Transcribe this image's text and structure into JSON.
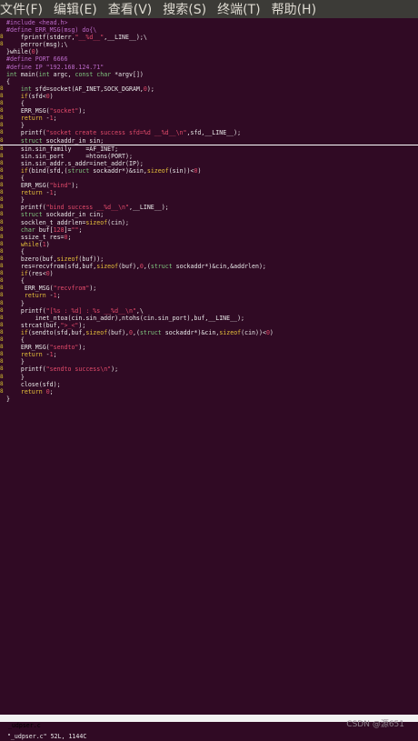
{
  "menubar": {
    "items": [
      "文件(F)",
      "编辑(E)",
      "查看(V)",
      "搜索(S)",
      "终端(T)",
      "帮助(H)"
    ]
  },
  "editor": {
    "cursor_line_index": 16,
    "lines": [
      {
        "g": "",
        "t": [
          [
            "pp",
            "#include <head.h>"
          ]
        ]
      },
      {
        "g": "",
        "t": [
          [
            "pp",
            "#define ERR_MSG(msg) do{\\"
          ]
        ]
      },
      {
        "g": "8",
        "t": [
          [
            "code",
            "    fprintf(stderr,"
          ],
          [
            "str",
            "\"__%d__\""
          ],
          [
            "code",
            ",__LINE__);\\"
          ]
        ]
      },
      {
        "g": "8",
        "t": [
          [
            "code",
            "    perror(msg);\\"
          ]
        ]
      },
      {
        "g": "",
        "t": [
          [
            "code",
            "}while("
          ],
          [
            "num",
            "0"
          ],
          [
            "code",
            ")"
          ]
        ]
      },
      {
        "g": "",
        "t": [
          [
            "pp",
            "#define PORT 6666"
          ]
        ]
      },
      {
        "g": "",
        "t": [
          [
            "pp",
            "#define IP \"192.168.124.71\""
          ]
        ]
      },
      {
        "g": "",
        "t": [
          [
            "ty",
            "int"
          ],
          [
            "code",
            " main("
          ],
          [
            "ty",
            "int"
          ],
          [
            "code",
            " argc, "
          ],
          [
            "ty",
            "const char"
          ],
          [
            "code",
            " *argv[])"
          ]
        ]
      },
      {
        "g": "",
        "t": [
          [
            "code",
            "{"
          ]
        ]
      },
      {
        "g": "8",
        "t": [
          [
            "ty",
            "    int"
          ],
          [
            "code",
            " sfd=socket(AF_INET,SOCK_DGRAM,"
          ],
          [
            "num",
            "0"
          ],
          [
            "code",
            ");"
          ]
        ]
      },
      {
        "g": "8",
        "t": [
          [
            "kw",
            "    if"
          ],
          [
            "code",
            "(sfd<"
          ],
          [
            "num",
            "0"
          ],
          [
            "code",
            ")"
          ]
        ]
      },
      {
        "g": "8",
        "t": [
          [
            "code",
            "    {"
          ]
        ]
      },
      {
        "g": "8",
        "t": [
          [
            "code",
            "    ERR_MSG("
          ],
          [
            "str",
            "\"socket\""
          ],
          [
            "code",
            ");"
          ]
        ]
      },
      {
        "g": "8",
        "t": [
          [
            "kw",
            "    return"
          ],
          [
            "code",
            " -"
          ],
          [
            "num",
            "1"
          ],
          [
            "code",
            ";"
          ]
        ]
      },
      {
        "g": "8",
        "t": [
          [
            "code",
            "    }"
          ]
        ]
      },
      {
        "g": "8",
        "t": [
          [
            "code",
            "    printf("
          ],
          [
            "str",
            "\"socket create success sfd=%d __%d__\\n\""
          ],
          [
            "code",
            ",sfd,__LINE__);"
          ]
        ]
      },
      {
        "g": "8",
        "t": [
          [
            "ty",
            "    struct"
          ],
          [
            "code",
            " sockaddr_in sin;"
          ]
        ]
      },
      {
        "g": "8",
        "t": [
          [
            "code",
            "    sin.sin_family    =AF_INET;"
          ]
        ]
      },
      {
        "g": "8",
        "t": [
          [
            "code",
            "    sin.sin_port      =htons(PORT);"
          ]
        ]
      },
      {
        "g": "8",
        "t": [
          [
            "code",
            "    sin.sin_addr.s_addr=inet_addr(IP);"
          ]
        ]
      },
      {
        "g": "8",
        "t": [
          [
            "kw",
            "    if"
          ],
          [
            "code",
            "(bind(sfd,("
          ],
          [
            "ty",
            "struct"
          ],
          [
            "code",
            " sockaddr*)&sin,"
          ],
          [
            "kw",
            "sizeof"
          ],
          [
            "code",
            "(sin))<"
          ],
          [
            "num",
            "0"
          ],
          [
            "code",
            ")"
          ]
        ]
      },
      {
        "g": "8",
        "t": [
          [
            "code",
            "    {"
          ]
        ]
      },
      {
        "g": "8",
        "t": [
          [
            "code",
            "    ERR_MSG("
          ],
          [
            "str",
            "\"bind\""
          ],
          [
            "code",
            ");"
          ]
        ]
      },
      {
        "g": "8",
        "t": [
          [
            "kw",
            "    return"
          ],
          [
            "code",
            " -"
          ],
          [
            "num",
            "1"
          ],
          [
            "code",
            ";"
          ]
        ]
      },
      {
        "g": "8",
        "t": [
          [
            "code",
            "    }"
          ]
        ]
      },
      {
        "g": "8",
        "t": [
          [
            "code",
            "    printf("
          ],
          [
            "str",
            "\"bind success __%d__\\n\""
          ],
          [
            "code",
            ",__LINE__);"
          ]
        ]
      },
      {
        "g": "8",
        "t": [
          [
            "ty",
            "    struct"
          ],
          [
            "code",
            " sockaddr_in cin;"
          ]
        ]
      },
      {
        "g": "8",
        "t": [
          [
            "code",
            "    socklen_t addrlen="
          ],
          [
            "kw",
            "sizeof"
          ],
          [
            "code",
            "(cin);"
          ]
        ]
      },
      {
        "g": "8",
        "t": [
          [
            "ty",
            "    char"
          ],
          [
            "code",
            " buf["
          ],
          [
            "num",
            "128"
          ],
          [
            "code",
            "]="
          ],
          [
            "str",
            "\"\""
          ],
          [
            "code",
            ";"
          ]
        ]
      },
      {
        "g": "8",
        "t": [
          [
            "code",
            "    ssize_t res="
          ],
          [
            "num",
            "0"
          ],
          [
            "code",
            ";"
          ]
        ]
      },
      {
        "g": "8",
        "t": [
          [
            "kw",
            "    while"
          ],
          [
            "code",
            "("
          ],
          [
            "num",
            "1"
          ],
          [
            "code",
            ")"
          ]
        ]
      },
      {
        "g": "8",
        "t": [
          [
            "code",
            "    {"
          ]
        ]
      },
      {
        "g": "8",
        "t": [
          [
            "code",
            "    bzero(buf,"
          ],
          [
            "kw",
            "sizeof"
          ],
          [
            "code",
            "(buf));"
          ]
        ]
      },
      {
        "g": "8",
        "t": [
          [
            "code",
            "    res=recvfrom(sfd,buf,"
          ],
          [
            "kw",
            "sizeof"
          ],
          [
            "code",
            "(buf),"
          ],
          [
            "num",
            "0"
          ],
          [
            "code",
            ",("
          ],
          [
            "ty",
            "struct"
          ],
          [
            "code",
            " sockaddr*)&cin,&addrlen);"
          ]
        ]
      },
      {
        "g": "8",
        "t": [
          [
            "kw",
            "    if"
          ],
          [
            "code",
            "(res<"
          ],
          [
            "num",
            "0"
          ],
          [
            "code",
            ")"
          ]
        ]
      },
      {
        "g": "8",
        "t": [
          [
            "code",
            "    {"
          ]
        ]
      },
      {
        "g": "8",
        "t": [
          [
            "code",
            "     ERR_MSG("
          ],
          [
            "str",
            "\"recvfrom\""
          ],
          [
            "code",
            ");"
          ]
        ]
      },
      {
        "g": "8",
        "t": [
          [
            "kw",
            "     return"
          ],
          [
            "code",
            " -"
          ],
          [
            "num",
            "1"
          ],
          [
            "code",
            ";"
          ]
        ]
      },
      {
        "g": "8",
        "t": [
          [
            "code",
            "    }"
          ]
        ]
      },
      {
        "g": "8",
        "t": [
          [
            "code",
            "    printf("
          ],
          [
            "str",
            "\"[%s : %d] : %s __%d__\\n\""
          ],
          [
            "code",
            ",\\"
          ]
        ]
      },
      {
        "g": "8",
        "t": [
          [
            "code",
            "        inet_ntoa(cin.sin_addr),ntohs(cin.sin_port),buf,__LINE__);"
          ]
        ]
      },
      {
        "g": "8",
        "t": [
          [
            "code",
            "    strcat(buf,"
          ],
          [
            "str",
            "\">_<\""
          ],
          [
            "code",
            ");"
          ]
        ]
      },
      {
        "g": "8",
        "t": [
          [
            "kw",
            "    if"
          ],
          [
            "code",
            "(sendto(sfd,buf,"
          ],
          [
            "kw",
            "sizeof"
          ],
          [
            "code",
            "(buf),"
          ],
          [
            "num",
            "0"
          ],
          [
            "code",
            ",("
          ],
          [
            "ty",
            "struct"
          ],
          [
            "code",
            " sockaddr*)&cin,"
          ],
          [
            "kw",
            "sizeof"
          ],
          [
            "code",
            "(cin))<"
          ],
          [
            "num",
            "0"
          ],
          [
            "code",
            ")"
          ]
        ]
      },
      {
        "g": "8",
        "t": [
          [
            "code",
            "    {"
          ]
        ]
      },
      {
        "g": "8",
        "t": [
          [
            "code",
            "    ERR_MSG("
          ],
          [
            "str",
            "\"sendto\""
          ],
          [
            "code",
            ");"
          ]
        ]
      },
      {
        "g": "8",
        "t": [
          [
            "kw",
            "    return"
          ],
          [
            "code",
            " -"
          ],
          [
            "num",
            "1"
          ],
          [
            "code",
            ";"
          ]
        ]
      },
      {
        "g": "8",
        "t": [
          [
            "code",
            "    }"
          ]
        ]
      },
      {
        "g": "8",
        "t": [
          [
            "code",
            "    printf("
          ],
          [
            "str",
            "\"sendto success\\n\""
          ],
          [
            "code",
            ");"
          ]
        ]
      },
      {
        "g": "8",
        "t": [
          [
            "code",
            "    }"
          ]
        ]
      },
      {
        "g": "8",
        "t": [
          [
            "code",
            "    close(sfd);"
          ]
        ]
      },
      {
        "g": "8",
        "t": [
          [
            "kw",
            "    return"
          ],
          [
            "code",
            " "
          ],
          [
            "num",
            "0"
          ],
          [
            "code",
            ";"
          ]
        ]
      },
      {
        "g": "",
        "t": [
          [
            "code",
            "}"
          ]
        ]
      }
    ]
  },
  "statusbar": {
    "filename": "_udpser.c"
  },
  "cmdline": {
    "text": "\"_udpser.c\" 52L, 1144C"
  },
  "watermark": "CSDN @源651"
}
